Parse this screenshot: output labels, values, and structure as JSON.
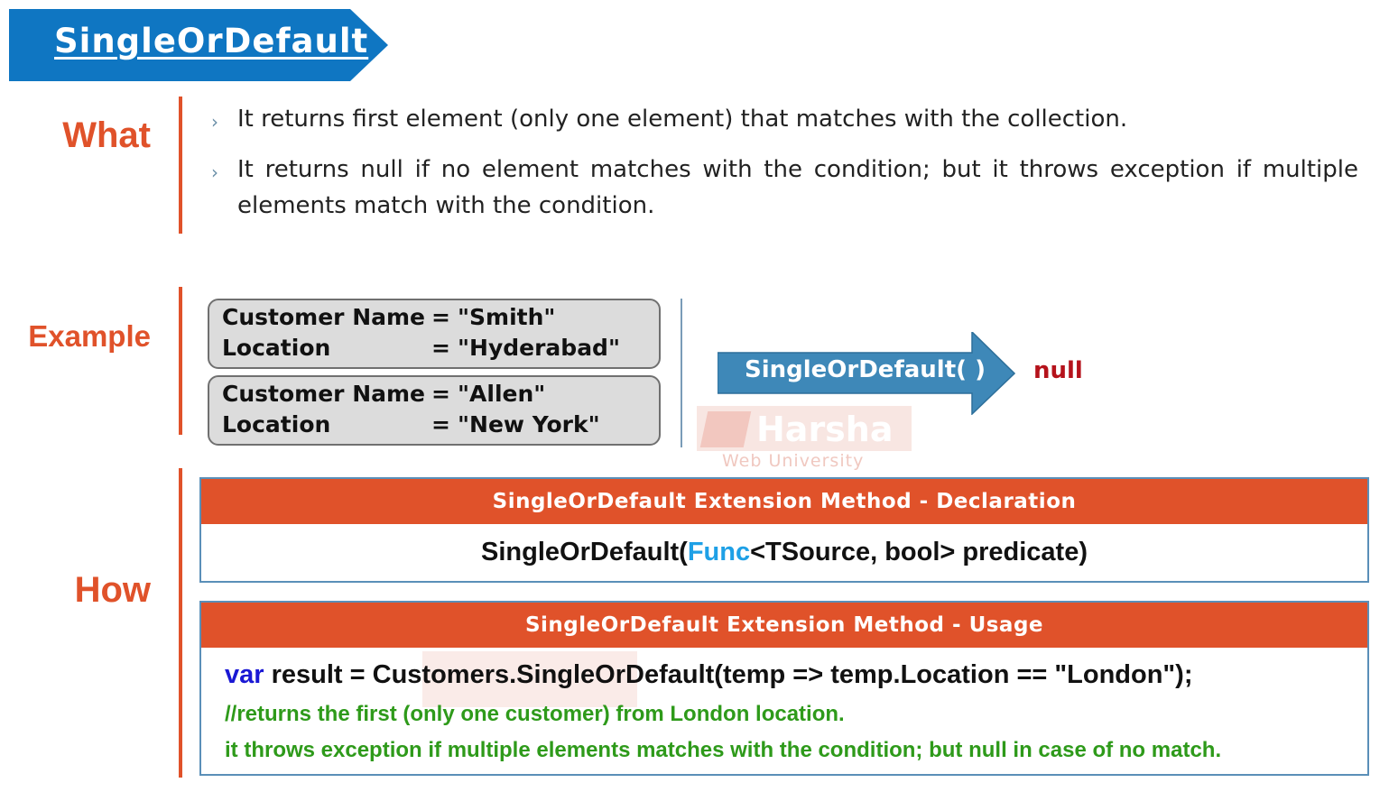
{
  "title": "SingleOrDefault",
  "colors": {
    "banner_blue": "#0f76c2",
    "accent_orange": "#e0522a",
    "arrow_blue": "#3e88b8",
    "null_red": "#b5121b",
    "func_blue": "#1ea0e6",
    "keyword_blue": "#1a18d4",
    "comment_green": "#2e9a1a"
  },
  "what": {
    "label": "What",
    "bullet_icon": "chevron-right-icon",
    "bullets": [
      "It returns first element (only one element) that matches with the collection.",
      "It returns null if no element matches with the condition; but it throws exception if multiple elements match with the condition."
    ]
  },
  "example": {
    "label": "Example",
    "records": [
      {
        "name_key": "Customer Name",
        "name_value": "\"Smith\"",
        "location_key": "Location",
        "location_value": "\"Hyderabad\""
      },
      {
        "name_key": "Customer Name",
        "name_value": "\"Allen\"",
        "location_key": "Location",
        "location_value": "\"New York\""
      }
    ],
    "equals": "=",
    "method_arrow_label": "SingleOrDefault( )",
    "result": "null"
  },
  "watermark": {
    "brand": "Harsha",
    "sub": "Web University"
  },
  "how": {
    "label": "How",
    "declaration": {
      "header": "SingleOrDefault Extension Method - Declaration",
      "prefix": "SingleOrDefault(",
      "func": "Func",
      "suffix": "<TSource, bool>  predicate)"
    },
    "usage": {
      "header": "SingleOrDefault Extension Method - Usage",
      "keyword": "var",
      "code": " result = Customers.SingleOrDefault(temp => temp.Location == \"London\");",
      "comment1": "//returns the first (only one customer) from London location.",
      "comment2": "it throws exception if multiple elements matches with the condition; but null in case of no match."
    }
  }
}
